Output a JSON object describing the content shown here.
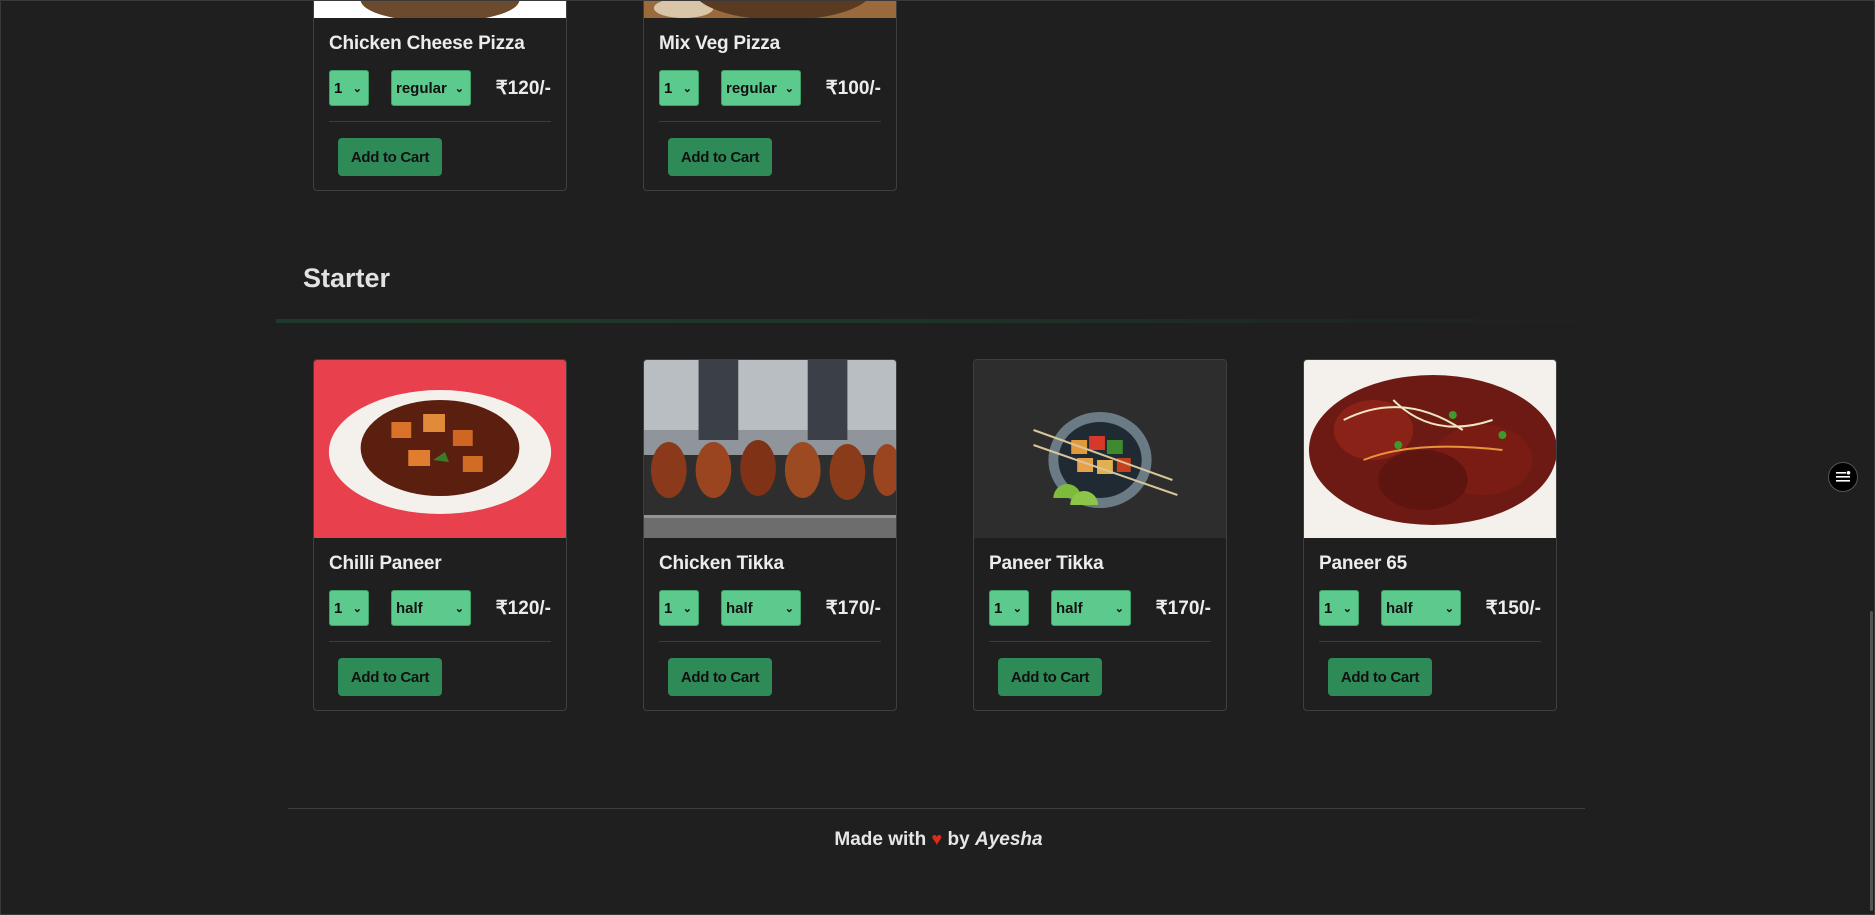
{
  "top_items": [
    {
      "name": "Chicken Cheese Pizza",
      "qty": "1",
      "size": "regular",
      "price": "₹120/-",
      "button": "Add to Cart",
      "image": "pizza-photo"
    },
    {
      "name": "Mix Veg Pizza",
      "qty": "1",
      "size": "regular",
      "price": "₹100/-",
      "button": "Add to Cart",
      "image": "pizza-photo"
    }
  ],
  "section": {
    "title": "Starter"
  },
  "starter_items": [
    {
      "name": "Chilli Paneer",
      "qty": "1",
      "size": "half",
      "price": "₹120/-",
      "button": "Add to Cart",
      "image": "chilli-paneer-photo"
    },
    {
      "name": "Chicken Tikka",
      "qty": "1",
      "size": "half",
      "price": "₹170/-",
      "button": "Add to Cart",
      "image": "chicken-tikka-photo"
    },
    {
      "name": "Paneer Tikka",
      "qty": "1",
      "size": "half",
      "price": "₹170/-",
      "button": "Add to Cart",
      "image": "paneer-tikka-photo"
    },
    {
      "name": "Paneer 65",
      "qty": "1",
      "size": "half",
      "price": "₹150/-",
      "button": "Add to Cart",
      "image": "paneer-65-photo"
    }
  ],
  "footer": {
    "made_with": "Made with",
    "by": "by",
    "author": "Ayesha",
    "heart": "♥"
  },
  "icons": {
    "menu": "menu-list-icon",
    "select_arrow": "chevron-down-icon"
  },
  "colors": {
    "background": "#1f1f1f",
    "select": "#5cc98d",
    "button": "#2e8b57",
    "heart": "#e0291c"
  }
}
